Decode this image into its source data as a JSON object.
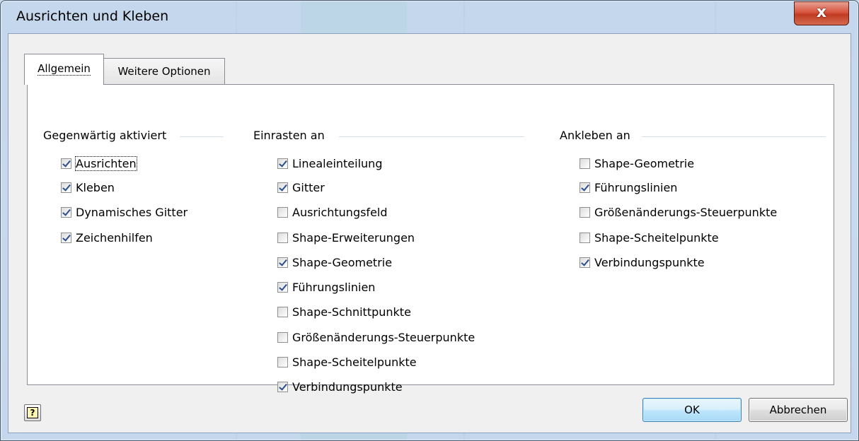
{
  "window": {
    "title": "Ausrichten und Kleben",
    "close_label": "x"
  },
  "tabs": [
    {
      "label": "Allgemein",
      "active": true
    },
    {
      "label": "Weitere Optionen",
      "active": false
    }
  ],
  "groups": {
    "current": {
      "title": "Gegenwärtig aktiviert",
      "items": [
        {
          "label": "Ausrichten",
          "checked": true
        },
        {
          "label": "Kleben",
          "checked": true
        },
        {
          "label": "Dynamisches Gitter",
          "checked": true
        },
        {
          "label": "Zeichenhilfen",
          "checked": true
        }
      ]
    },
    "snap": {
      "title": "Einrasten an",
      "items": [
        {
          "label": "Linealeinteilung",
          "checked": true
        },
        {
          "label": "Gitter",
          "checked": true
        },
        {
          "label": "Ausrichtungsfeld",
          "checked": false
        },
        {
          "label": "Shape-Erweiterungen",
          "checked": false
        },
        {
          "label": "Shape-Geometrie",
          "checked": true
        },
        {
          "label": "Führungslinien",
          "checked": true
        },
        {
          "label": "Shape-Schnittpunkte",
          "checked": false
        },
        {
          "label": "Größenänderungs-Steuerpunkte",
          "checked": false
        },
        {
          "label": "Shape-Scheitelpunkte",
          "checked": false
        },
        {
          "label": "Verbindungspunkte",
          "checked": true
        }
      ]
    },
    "glue": {
      "title": "Ankleben an",
      "items": [
        {
          "label": "Shape-Geometrie",
          "checked": false
        },
        {
          "label": "Führungslinien",
          "checked": true
        },
        {
          "label": "Größenänderungs-Steuerpunkte",
          "checked": false
        },
        {
          "label": "Shape-Scheitelpunkte",
          "checked": false
        },
        {
          "label": "Verbindungspunkte",
          "checked": true
        }
      ]
    }
  },
  "buttons": {
    "help_icon": "?",
    "ok": "OK",
    "cancel": "Abbrechen"
  },
  "icons": {
    "close": "close-icon",
    "help": "help-icon",
    "checkmark": "checkmark-icon"
  },
  "colors": {
    "close_button": "#c7452a",
    "ok_button_border": "#3c7fb1",
    "checkmark": "#2b4f8f"
  }
}
